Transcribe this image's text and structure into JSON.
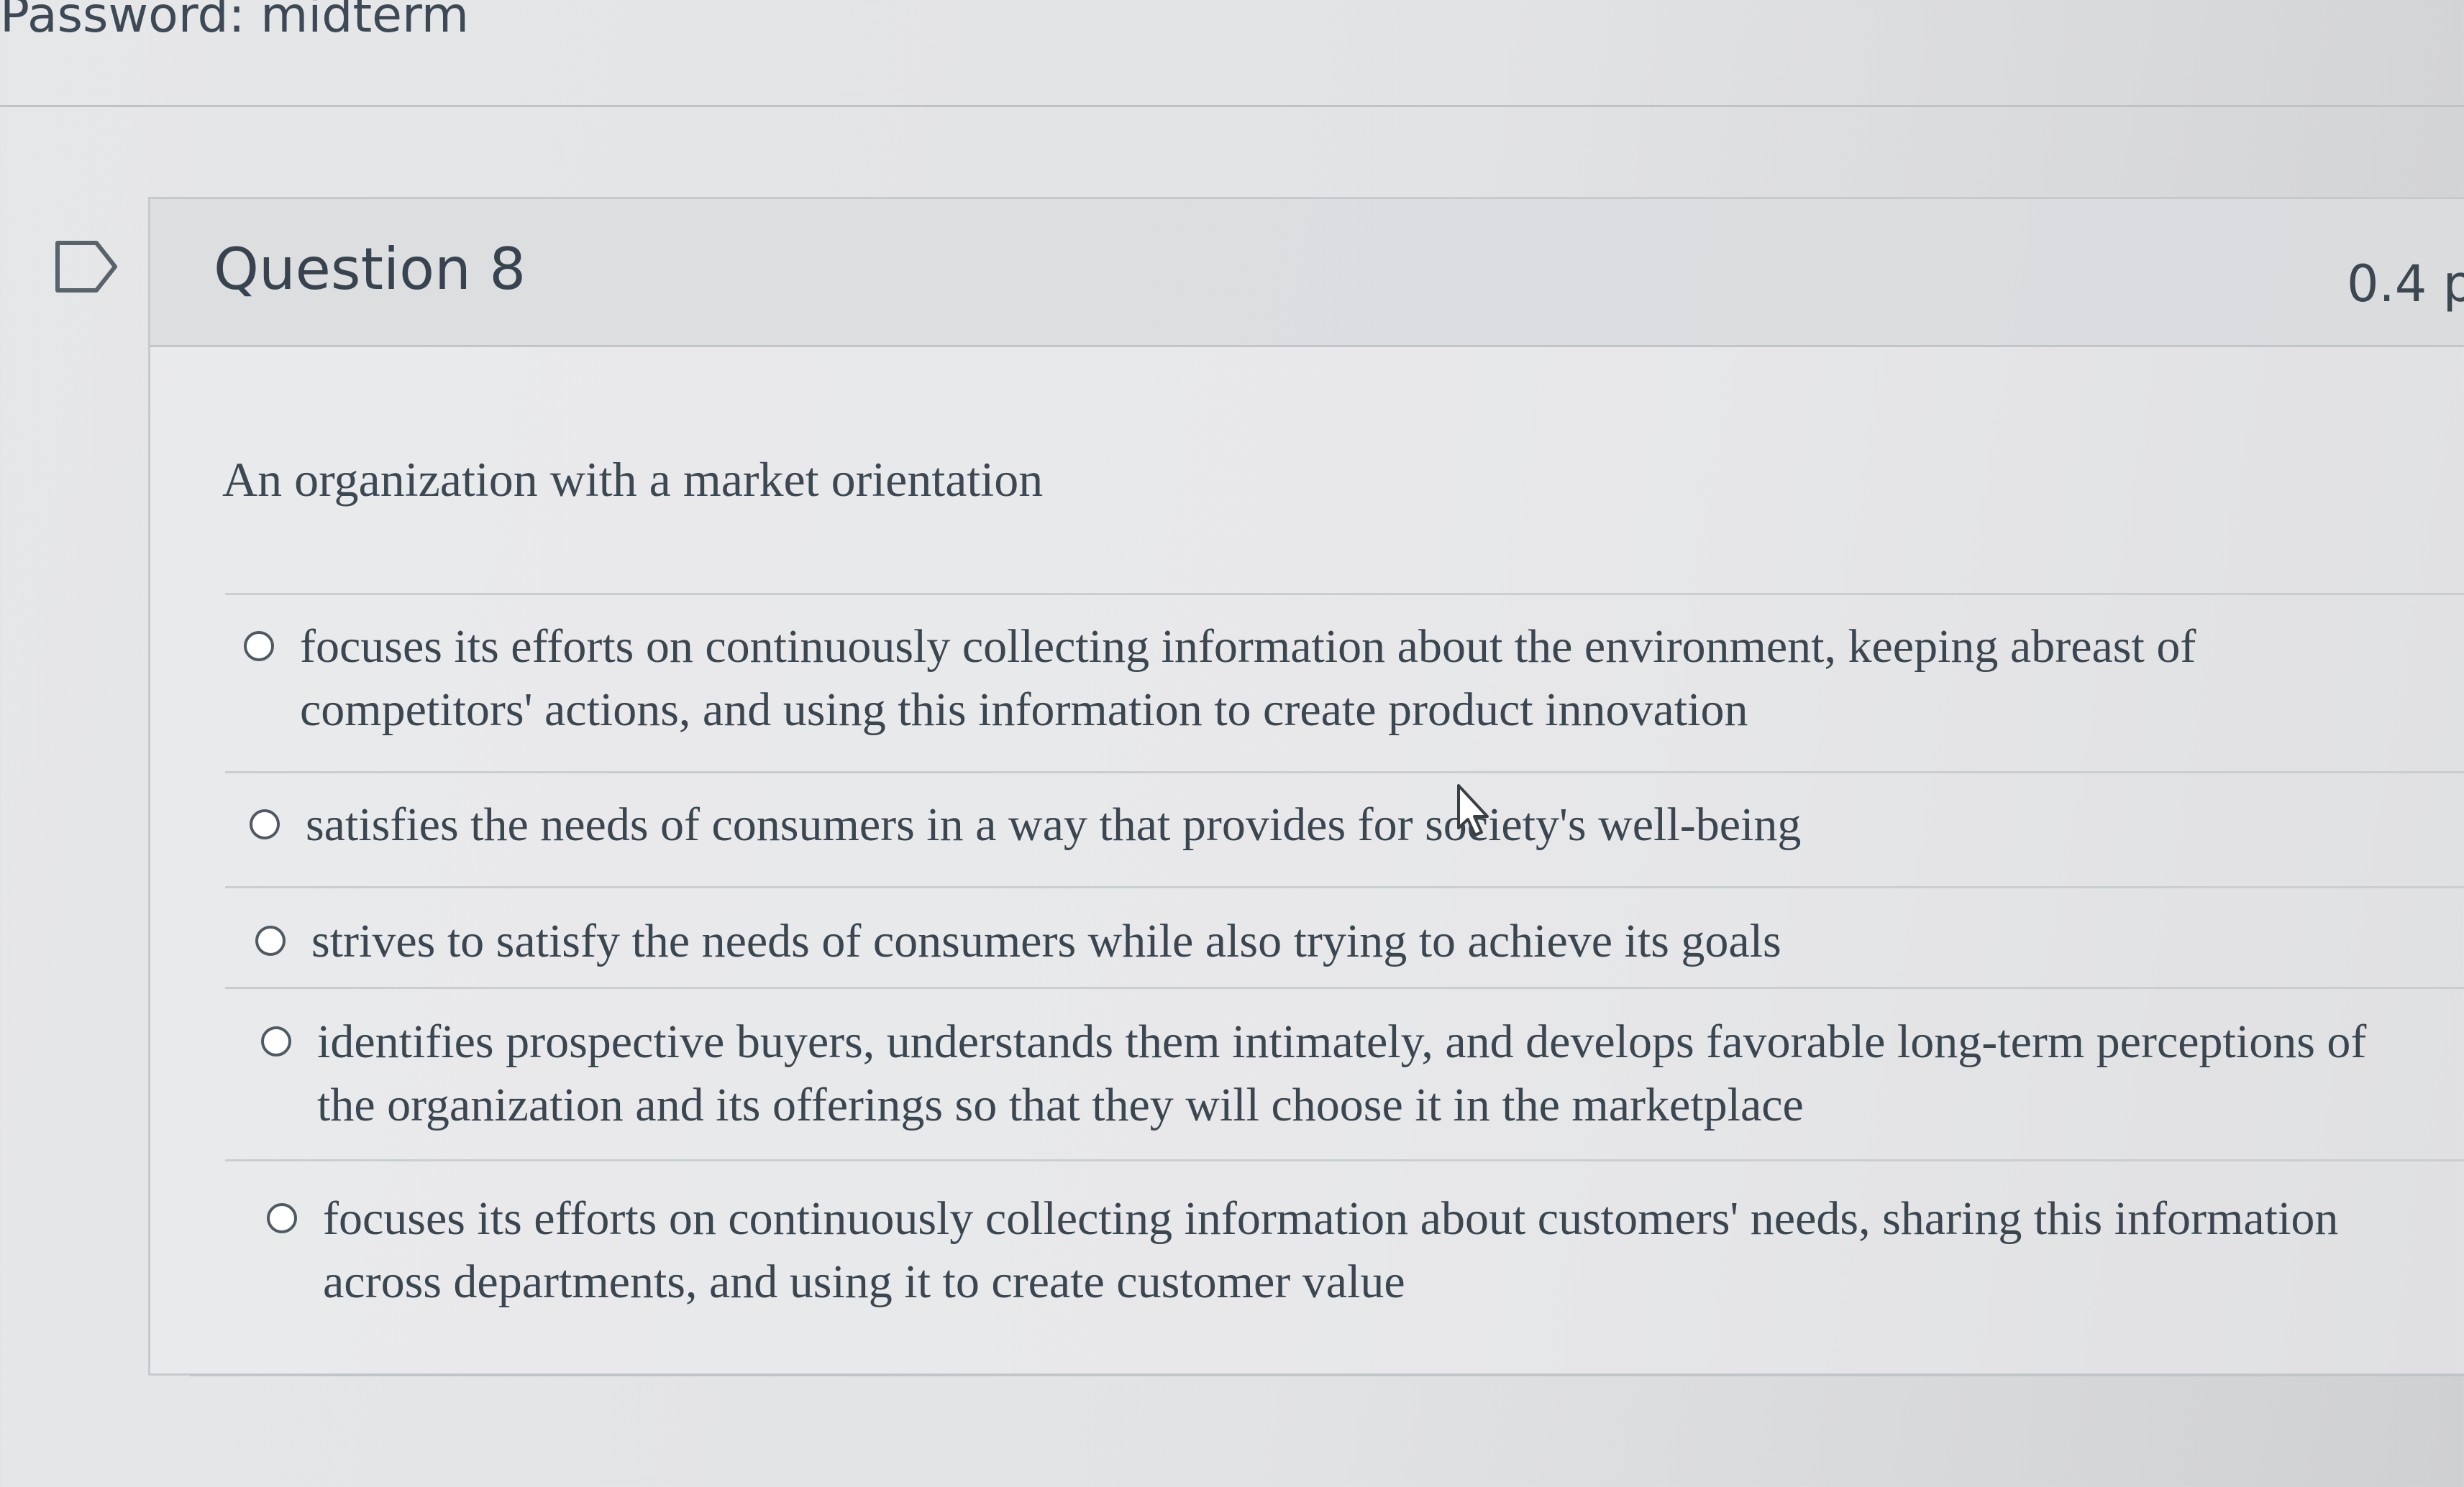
{
  "header": {
    "password_text": "Password: midterm"
  },
  "question": {
    "title": "Question 8",
    "points": "0.4 p",
    "prompt": "An organization with a market orientation",
    "answers": [
      {
        "line1": "focuses its efforts on continuously collecting information about the environment, keeping abreast of",
        "line2": "competitors' actions, and using this information to create product innovation"
      },
      {
        "line1": "satisfies the needs of consumers in a way that provides for society's well-being",
        "line2": ""
      },
      {
        "line1": "strives to satisfy the needs of consumers while also trying to achieve its goals",
        "line2": ""
      },
      {
        "line1": "identifies prospective buyers, understands them intimately, and develops favorable long-term perceptions of",
        "line2": "the organization and its offerings so that they will choose it in the marketplace"
      },
      {
        "line1": "focuses its efforts on continuously collecting information about customers' needs, sharing this information",
        "line2": "across departments, and using it to create customer value"
      }
    ]
  },
  "icons": {
    "flag": "flag-question-icon",
    "cursor": "mouse-pointer-icon"
  }
}
